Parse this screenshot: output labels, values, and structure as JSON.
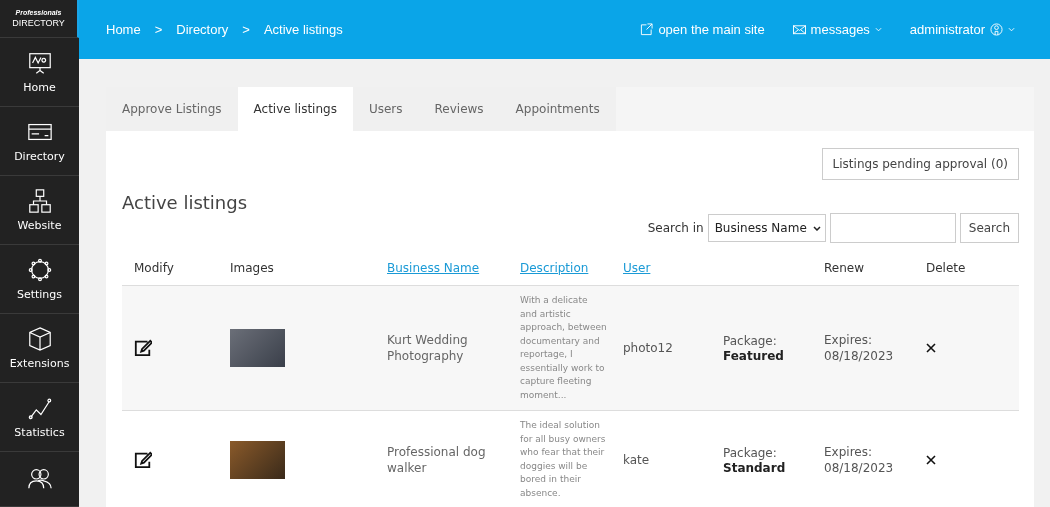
{
  "logo": {
    "top": "Professionals",
    "bottom": "DIRECTORY"
  },
  "sidebar": {
    "items": [
      {
        "label": "Home"
      },
      {
        "label": "Directory"
      },
      {
        "label": "Website"
      },
      {
        "label": "Settings"
      },
      {
        "label": "Extensions"
      },
      {
        "label": "Statistics"
      }
    ]
  },
  "breadcrumb": [
    {
      "label": "Home"
    },
    {
      "separator": ">",
      "label": "Directory"
    },
    {
      "separator": ">",
      "label": "Active listings"
    }
  ],
  "top_links": [
    {
      "label": "open the main site",
      "dropdown": false
    },
    {
      "label": "messages",
      "dropdown": true
    },
    {
      "label": "administrator",
      "dropdown": true
    }
  ],
  "tabs": [
    {
      "label": "Approve Listings",
      "selected": false
    },
    {
      "label": "Active listings",
      "selected": true
    },
    {
      "label": "Users",
      "selected": false
    },
    {
      "label": "Reviews",
      "selected": false
    },
    {
      "label": "Appointments",
      "selected": false
    }
  ],
  "pending_button": "Listings pending approval (0)",
  "heading": "Active listings",
  "search": {
    "label": "Search in",
    "field": "Business Name",
    "button": "Search"
  },
  "table": {
    "columns": [
      {
        "label": "Modify",
        "sortable": false
      },
      {
        "label": "Images",
        "sortable": false
      },
      {
        "label": "Business Name",
        "sortable": true
      },
      {
        "label": "Description",
        "sortable": true
      },
      {
        "label": "User",
        "sortable": true
      },
      {
        "label": "Renew",
        "sortable": false
      },
      {
        "label": "Delete",
        "sortable": false
      }
    ],
    "rows": [
      {
        "business_name": "Kurt Wedding Photography",
        "description": "With a delicate and artistic approach, between documentary and reportage, I essentially work to capture fleeting moment...",
        "user": "photo12",
        "package_label": "Package:",
        "package": "Featured",
        "renew": "Expires: 08/18/2023"
      },
      {
        "business_name": "Professional dog walker",
        "description": "The ideal solution for all busy owners who fear that their doggies will be bored in their absence.",
        "user": "kate",
        "package_label": "Package:",
        "package": "Standard",
        "renew": "Expires: 08/18/2023"
      }
    ]
  }
}
